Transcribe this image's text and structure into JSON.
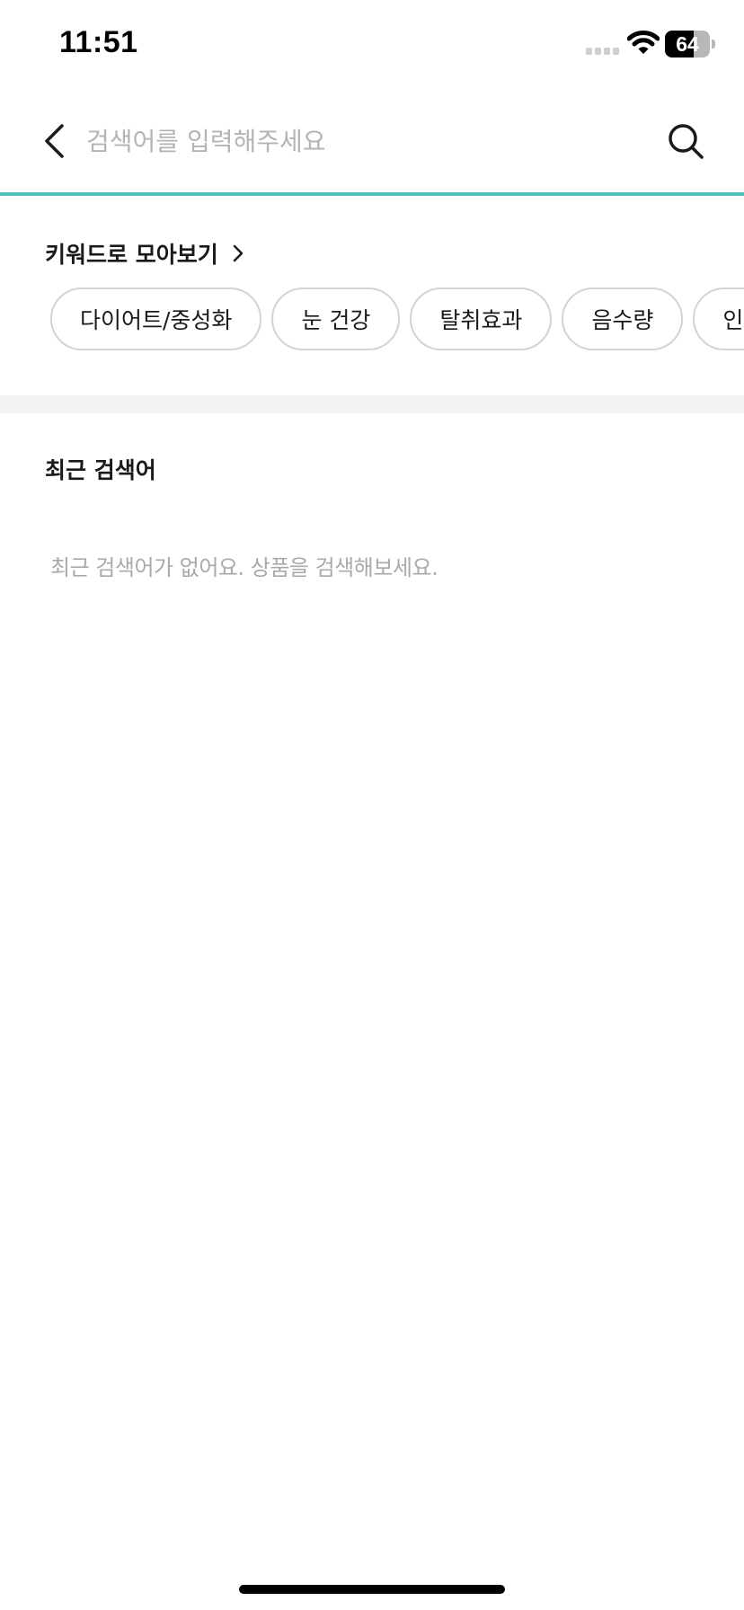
{
  "status_bar": {
    "time": "11:51",
    "battery_percent": "64",
    "battery_level": 0.64,
    "icons": [
      "signal-icon",
      "wifi-icon",
      "battery-icon"
    ]
  },
  "search": {
    "placeholder": "검색어를 입력해주세요",
    "value": "",
    "back_icon": "chevron-left-icon",
    "search_icon": "search-icon"
  },
  "keywords": {
    "title": "키워드로 모아보기",
    "title_icon": "chevron-right-icon",
    "chips": [
      {
        "label": "다이어트/중성화"
      },
      {
        "label": "눈 건강"
      },
      {
        "label": "탈취효과"
      },
      {
        "label": "음수량"
      },
      {
        "label": "인테리어"
      }
    ]
  },
  "recent": {
    "title": "최근 검색어",
    "empty_message": "최근 검색어가 없어요. 상품을 검색해보세요."
  },
  "colors": {
    "accent": "#4bbfc4",
    "chip_border": "#d3d3d3",
    "placeholder": "#b4b4b4",
    "muted_text": "#a9a9a9",
    "divider": "#f2f2f2"
  }
}
